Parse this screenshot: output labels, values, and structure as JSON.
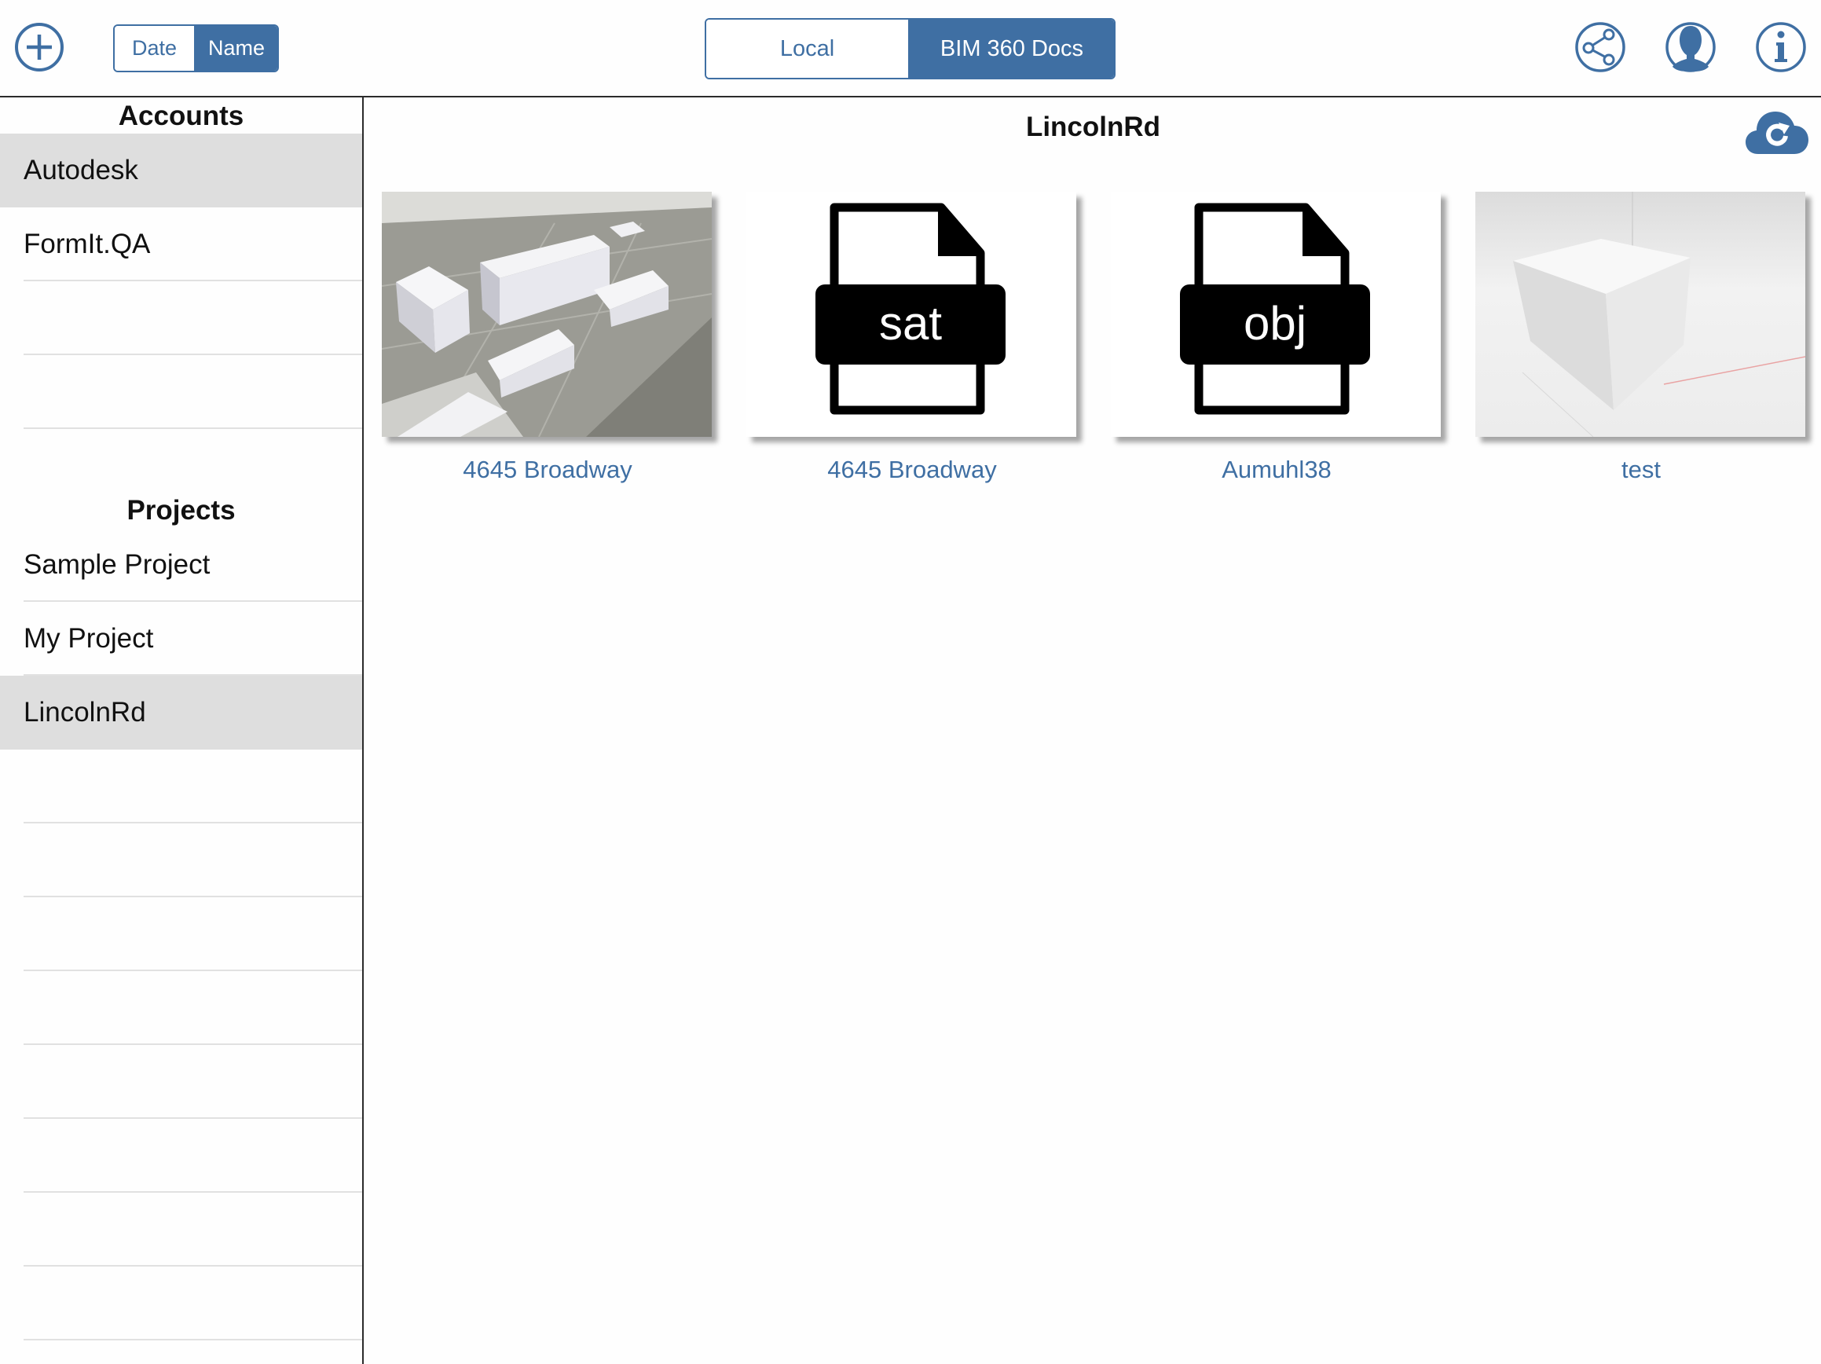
{
  "toolbar": {
    "add_icon": "plus-circle-icon",
    "sort": {
      "date_label": "Date",
      "name_label": "Name",
      "selected": "Name"
    },
    "source": {
      "local_label": "Local",
      "cloud_label": "BIM 360 Docs",
      "selected": "BIM 360 Docs"
    },
    "share_icon": "share-icon",
    "user_icon": "user-icon",
    "info_icon": "info-icon",
    "accent_color": "#3f6fa3"
  },
  "sidebar": {
    "accounts_title": "Accounts",
    "accounts": [
      {
        "label": "Autodesk",
        "selected": true
      },
      {
        "label": "FormIt.QA",
        "selected": false
      }
    ],
    "projects_title": "Projects",
    "projects": [
      {
        "label": "Sample Project",
        "selected": false
      },
      {
        "label": "My Project",
        "selected": false
      },
      {
        "label": "LincolnRd",
        "selected": true
      }
    ]
  },
  "main": {
    "title": "LincolnRd",
    "refresh_icon": "cloud-refresh-icon",
    "files": [
      {
        "name": "4645 Broadway",
        "thumbnail": "aerial-buildings-thumbnail"
      },
      {
        "name": "4645 Broadway",
        "thumbnail": "sat-file-icon",
        "badge": "sat"
      },
      {
        "name": "Aumuhl38",
        "thumbnail": "obj-file-icon",
        "badge": "obj"
      },
      {
        "name": "test",
        "thumbnail": "cube-thumbnail"
      }
    ]
  }
}
